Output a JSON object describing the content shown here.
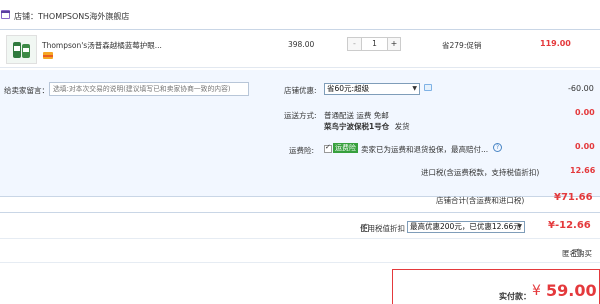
{
  "store": {
    "label": "店铺：",
    "name": "THOMPSONS海外旗舰店"
  },
  "product": {
    "name": "Thompson's汤普森越橘蓝莓护眼...",
    "price": "398.00",
    "quantity": "1",
    "qty_minus": "-",
    "qty_plus": "+",
    "discount": "省279:促销",
    "subtotal": "119.00"
  },
  "message": {
    "label": "给卖家留言：",
    "placeholder": "选填:对本次交易的说明(建议填写已和卖家协商一致的内容)"
  },
  "promo": {
    "label": "店铺优惠:",
    "selected": "省60元:超级",
    "amount": "-60.00"
  },
  "shipping": {
    "label": "运送方式:",
    "method": "普通配送 运费 免邮",
    "warehouse": "菜鸟宁波保税1号仓",
    "ship_text": "发货",
    "amount": "0.00"
  },
  "insurance": {
    "label": "运费险:",
    "badge": "运费险",
    "text": "卖家已为运费和退货投保，最高赔付...",
    "amount": "0.00"
  },
  "import_tax": {
    "text": "进口税(含运费税款，支持税值折扣)",
    "amount": "12.66"
  },
  "store_total": {
    "label": "店铺合计(含运费和进口税)",
    "amount": "¥71.66"
  },
  "tax_discount": {
    "label": "使用税值折扣",
    "selected": "最高优惠200元，已优惠12.66元",
    "amount": "¥-12.66"
  },
  "anonymous": {
    "label": "匿名购买"
  },
  "final": {
    "label": "实付款：",
    "currency": "¥",
    "amount": "59.00"
  },
  "colors": {
    "accent": "#e4393c",
    "panel": "#f2f7ff",
    "border": "#c9d6e6",
    "badge": "#37a03d"
  }
}
